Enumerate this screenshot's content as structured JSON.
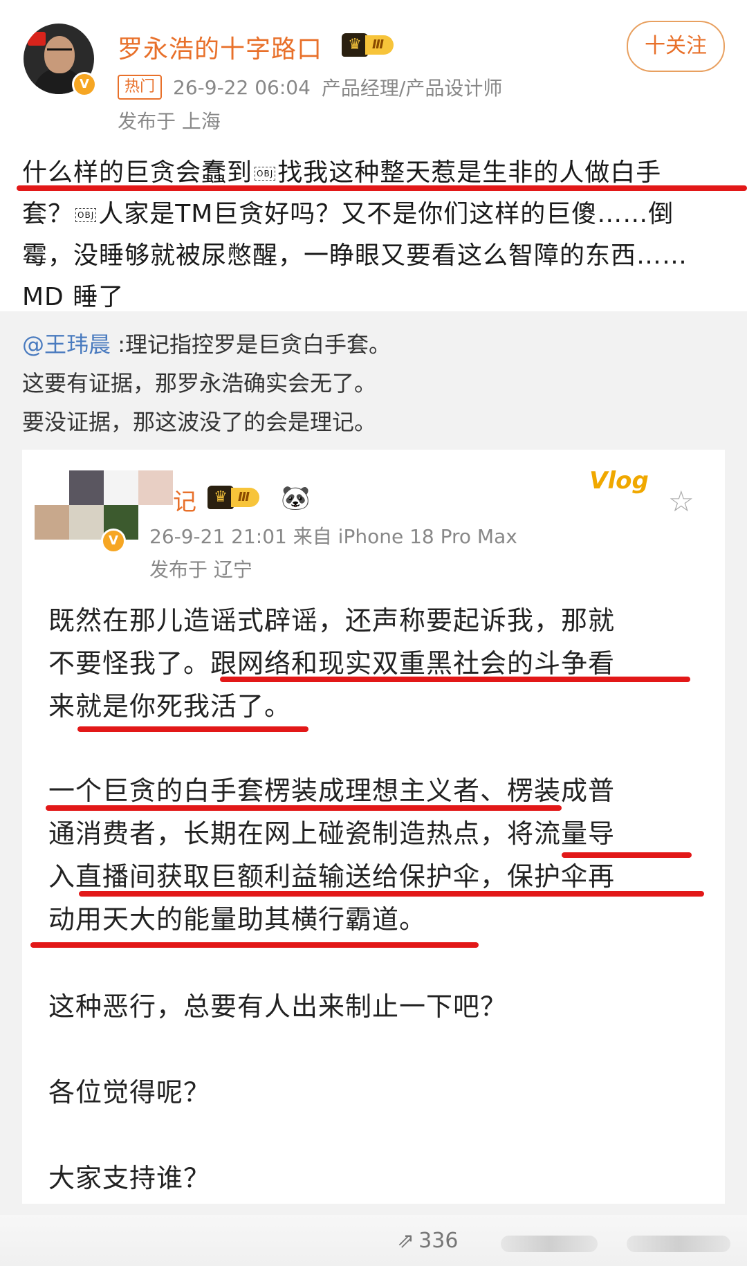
{
  "header": {
    "username": "罗永浩的十字路口",
    "level": "Ⅲ",
    "verified_mark": "V",
    "follow_button": "十关注",
    "hot_tag": "热门",
    "timestamp": "26-9-22 06:04",
    "role": "产品经理/产品设计师",
    "location": "发布于 上海",
    "icons": [
      "avatar",
      "verified-badge-icon",
      "crown-level-icon"
    ]
  },
  "post": {
    "line1": "什么样的巨贪会蠢到",
    "line1b": "找我这种整天惹是生非的人做白手",
    "line2a": "套？",
    "line2b": "人家是TM巨贪好吗？又不是你们这样的巨傻……倒",
    "line3": "霉，没睡够就被尿憋醒，一睁眼又要看这么智障的东西……",
    "line4": "MD 睡了",
    "obj_label": "OBJ"
  },
  "repost": {
    "mention": "@王玮晨",
    "line1": " :理记指控罗是巨贪白手套。",
    "line2": "这要有证据，那罗永浩确实会无了。",
    "line3": "要没证据，那这波没了的会是理记。"
  },
  "card": {
    "name_fragment": "记",
    "level": "Ⅲ",
    "verified_mark": "V",
    "timestamp": "26-9-21 21:01  来自 iPhone 18 Pro Max",
    "location": "发布于 辽宁",
    "sticker_text": "Vlog",
    "paragraphs": [
      [
        "既然在那儿造谣式辟谣，还声称要起诉我，那就",
        "不要怪我了。跟网络和现实双重黑社会的斗争看",
        "来就是你死我活了。"
      ],
      [
        "一个巨贪的白手套楞装成理想主义者、楞装成普",
        "通消费者，长期在网上碰瓷制造热点，将流量导",
        "入直播间获取巨额利益输送给保护伞，保护伞再",
        "动用天大的能量助其横行霸道。"
      ],
      [
        "这种恶行，总要有人出来制止一下吧？"
      ],
      [
        "各位觉得呢？"
      ],
      [
        "大家支持谁？"
      ]
    ]
  },
  "footer": {
    "share_count": "336",
    "icons": [
      "share-icon"
    ]
  },
  "colors": {
    "accent_orange": "#e8702a",
    "underline_red": "#e21818",
    "mention_blue": "#4a7bbf"
  }
}
